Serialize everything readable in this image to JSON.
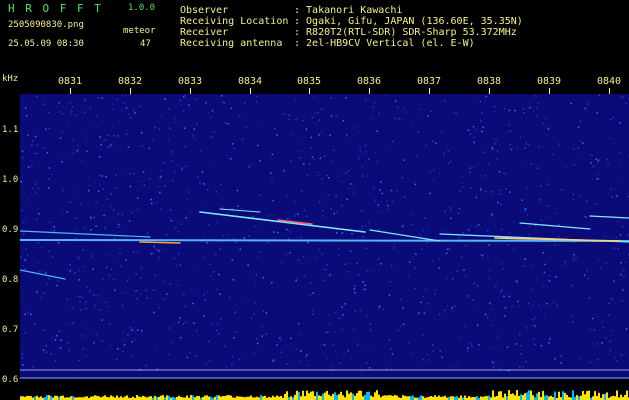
{
  "header": {
    "app_name": "H R O F F T",
    "version": "1.0.0",
    "filename": "2505090830.png",
    "datetime": "25.05.09 08:30",
    "meteor_label": "meteor",
    "meteor_count": "47",
    "fields": [
      {
        "label": "Observer",
        "value": ": Takanori Kawachi"
      },
      {
        "label": "Receiving Location",
        "value": ": Ogaki, Gifu, JAPAN (136.60E, 35.35N)"
      },
      {
        "label": "Receiver",
        "value": ": R820T2(RTL-SDR) SDR-Sharp 53.372MHz"
      },
      {
        "label": "Receiving antenna",
        "value": ": 2el-HB9CV Vertical (el. E-W)"
      }
    ]
  },
  "time_axis": {
    "ticks": [
      "0831",
      "0832",
      "0833",
      "0834",
      "0835",
      "0836",
      "0837",
      "0838",
      "0839",
      "0840"
    ]
  },
  "freq_axis": {
    "unit": "kHz",
    "ticks": [
      "1.1",
      "1.0",
      "0.9",
      "0.8",
      "0.7",
      "0.6"
    ]
  },
  "colors": {
    "header_text": "#f5f08c",
    "title_green": "#4fe35a",
    "background_noise": "#0a0a7a",
    "carrier_line": "#6ad0ff",
    "bottom_trace": "#ffe400",
    "bottom_trace_alt": "#00b8ff"
  }
}
